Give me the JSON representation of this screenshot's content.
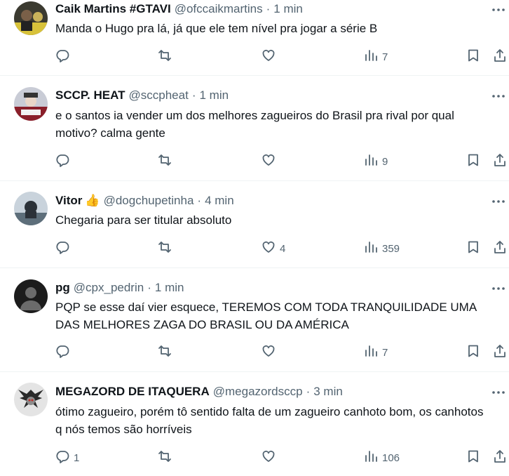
{
  "colors": {
    "text": "#0f1419",
    "muted": "#536471",
    "divider": "#eff3f4",
    "background": "#ffffff"
  },
  "icons": [
    "reply-icon",
    "retweet-icon",
    "like-icon",
    "views-icon",
    "bookmark-icon",
    "share-icon",
    "more-icon"
  ],
  "tweets": [
    {
      "name": "Caik Martins #GTAVI",
      "emoji": "",
      "handle": "@ofccaikmartins",
      "separator": "·",
      "time": "1 min",
      "text": "Manda o Hugo pra lá, já que ele tem nível pra jogar a série B",
      "replies": "",
      "retweets": "",
      "likes": "",
      "views": "7"
    },
    {
      "name": "SCCP. HEAT",
      "emoji": "",
      "handle": "@sccpheat",
      "separator": "·",
      "time": "1 min",
      "text": "e o santos ia vender um dos melhores zagueiros do Brasil pra rival por qual motivo? calma gente",
      "replies": "",
      "retweets": "",
      "likes": "",
      "views": "9"
    },
    {
      "name": "Vitor",
      "emoji": "👍",
      "handle": "@dogchupetinha",
      "separator": "·",
      "time": "4 min",
      "text": "Chegaria para ser titular absoluto",
      "replies": "",
      "retweets": "",
      "likes": "4",
      "views": "359"
    },
    {
      "name": "pg",
      "emoji": "",
      "handle": "@cpx_pedrin",
      "separator": "·",
      "time": "1 min",
      "text": "PQP se esse daí vier esquece, TEREMOS COM TODA TRANQUILIDADE UMA DAS MELHORES ZAGA DO BRASIL OU DA AMÉRICA",
      "replies": "",
      "retweets": "",
      "likes": "",
      "views": "7"
    },
    {
      "name": "MEGAZORD DE ITAQUERA",
      "emoji": "",
      "handle": "@megazordsccp",
      "separator": "·",
      "time": "3 min",
      "text": "ótimo zagueiro, porém tô sentido falta de um zagueiro canhoto bom, os canhotos q nós temos são horríveis",
      "replies": "1",
      "retweets": "",
      "likes": "",
      "views": "106"
    }
  ]
}
